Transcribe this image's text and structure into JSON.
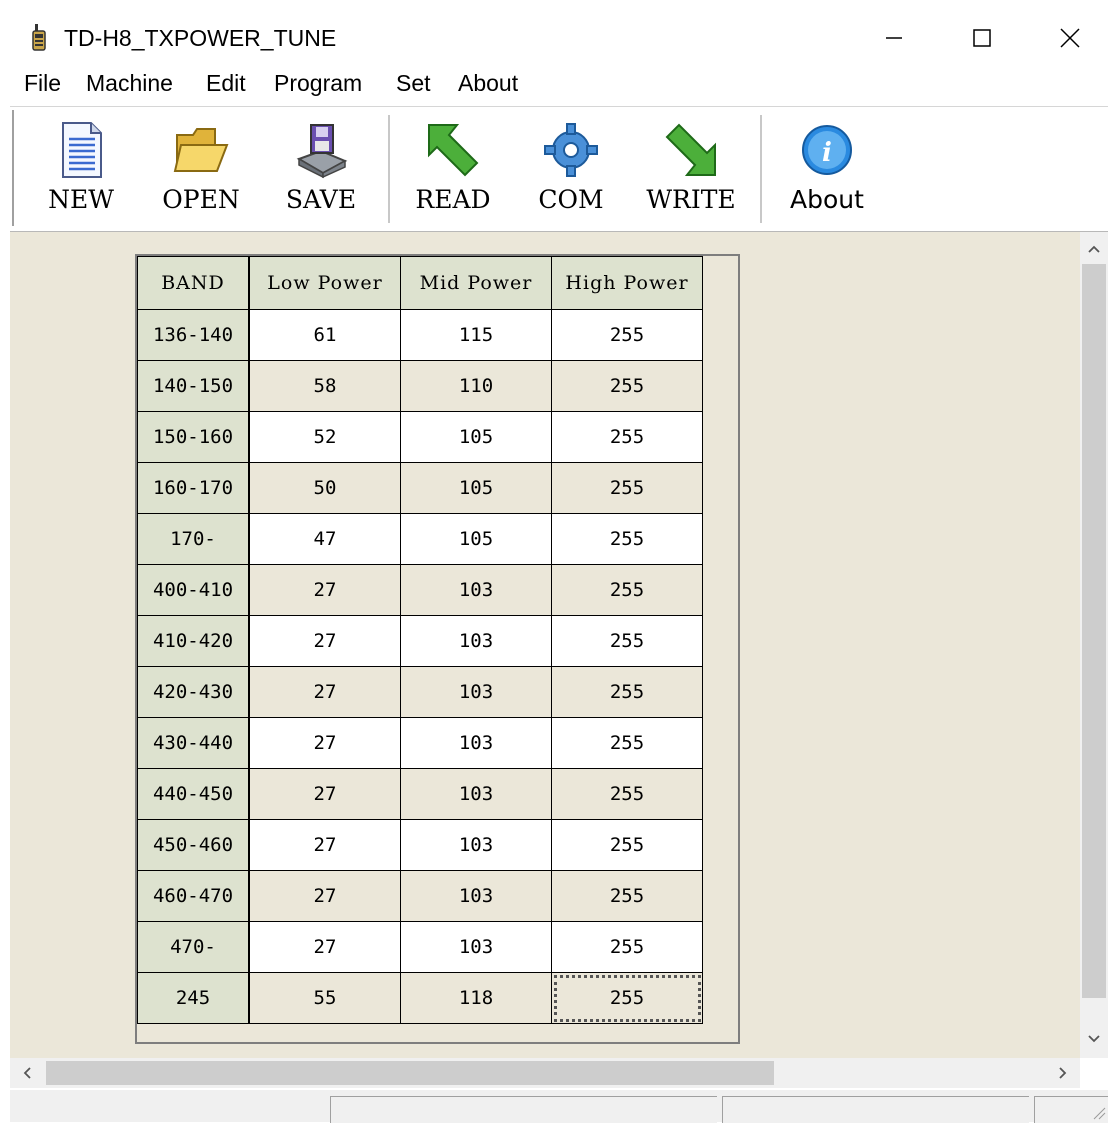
{
  "window": {
    "title": "TD-H8_TXPOWER_TUNE"
  },
  "menu": [
    "File",
    "Machine",
    "Edit",
    "Program",
    "Set",
    "About"
  ],
  "toolbar": {
    "new": "NEW",
    "open": "OPEN",
    "save": "SAVE",
    "read": "READ",
    "com": "COM",
    "write": "WRITE",
    "about": "About"
  },
  "table": {
    "headers": [
      "BAND",
      "Low Power",
      "Mid Power",
      "High Power"
    ],
    "rows": [
      [
        "136-140",
        "61",
        "115",
        "255"
      ],
      [
        "140-150",
        "58",
        "110",
        "255"
      ],
      [
        "150-160",
        "52",
        "105",
        "255"
      ],
      [
        "160-170",
        "50",
        "105",
        "255"
      ],
      [
        "170-",
        "47",
        "105",
        "255"
      ],
      [
        "400-410",
        "27",
        "103",
        "255"
      ],
      [
        "410-420",
        "27",
        "103",
        "255"
      ],
      [
        "420-430",
        "27",
        "103",
        "255"
      ],
      [
        "430-440",
        "27",
        "103",
        "255"
      ],
      [
        "440-450",
        "27",
        "103",
        "255"
      ],
      [
        "450-460",
        "27",
        "103",
        "255"
      ],
      [
        "460-470",
        "27",
        "103",
        "255"
      ],
      [
        "470-",
        "27",
        "103",
        "255"
      ],
      [
        "245",
        "55",
        "118",
        "255"
      ]
    ]
  },
  "colors": {
    "client_bg": "#ebe7d9",
    "band_cell": "#dde2cf"
  }
}
